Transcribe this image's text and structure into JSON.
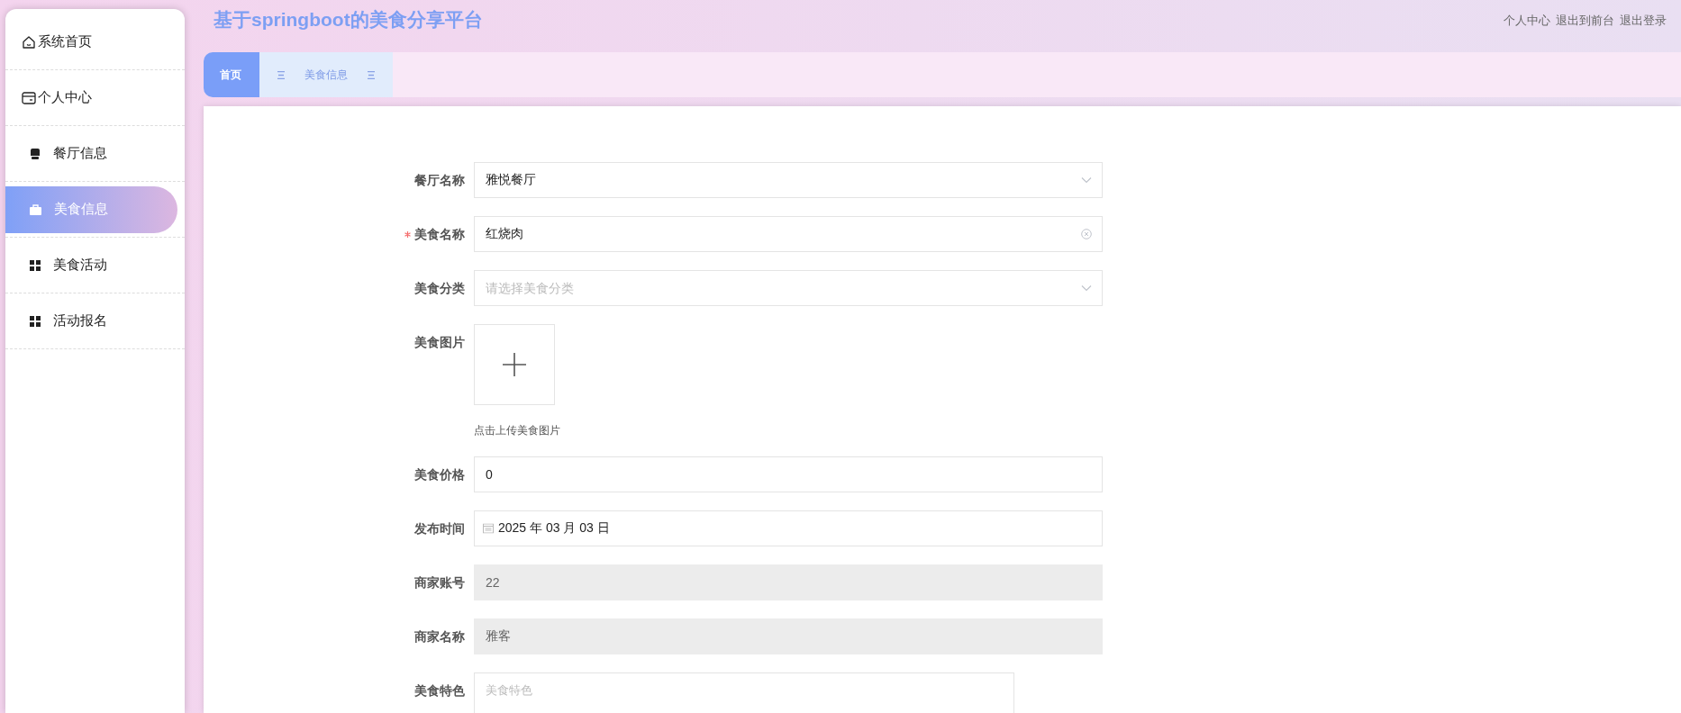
{
  "header": {
    "title": "基于springboot的美食分享平台",
    "links": [
      "个人中心",
      "退出到前台",
      "退出登录"
    ]
  },
  "sidebar": {
    "items": [
      {
        "label": "系统首页",
        "kind": "top",
        "selected": false
      },
      {
        "label": "个人中心",
        "kind": "top",
        "selected": false
      },
      {
        "label": "餐厅信息",
        "kind": "sub",
        "selected": false
      },
      {
        "label": "美食信息",
        "kind": "sub",
        "selected": true
      },
      {
        "label": "美食活动",
        "kind": "sub",
        "selected": false
      },
      {
        "label": "活动报名",
        "kind": "sub",
        "selected": false
      }
    ]
  },
  "tabs": [
    {
      "label": "首页",
      "selected": true
    },
    {
      "label": "美食信息",
      "selected": false
    }
  ],
  "form": {
    "fields": [
      {
        "label": "餐厅名称",
        "kind": "select",
        "value": "雅悦餐厅",
        "required": false,
        "disabled": false
      },
      {
        "label": "美食名称",
        "kind": "input",
        "value": "红烧肉",
        "required": true,
        "disabled": false,
        "clearable": true
      },
      {
        "label": "美食分类",
        "kind": "select",
        "placeholder": "请选择美食分类",
        "required": false,
        "disabled": false
      },
      {
        "label": "美食图片",
        "kind": "upload",
        "hint": "点击上传美食图片",
        "required": false,
        "disabled": false
      },
      {
        "label": "美食价格",
        "kind": "input",
        "value": "0",
        "required": false,
        "disabled": false,
        "clearable": false
      },
      {
        "label": "发布时间",
        "kind": "date",
        "value": "2025 年 03 月 03 日",
        "required": false,
        "disabled": false
      },
      {
        "label": "商家账号",
        "kind": "input",
        "value": "22",
        "required": false,
        "disabled": true,
        "clearable": false
      },
      {
        "label": "商家名称",
        "kind": "input",
        "value": "雅客",
        "required": false,
        "disabled": true,
        "clearable": false
      },
      {
        "label": "美食特色",
        "kind": "textarea",
        "placeholder": "美食特色",
        "required": false,
        "disabled": false
      }
    ]
  }
}
